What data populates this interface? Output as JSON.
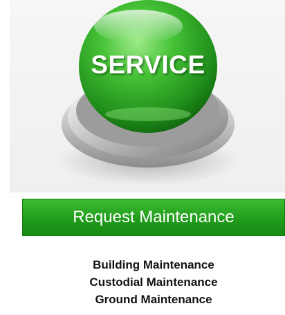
{
  "service_button": {
    "label": "SERVICE",
    "colors": {
      "green_light": "#8fe07a",
      "green_mid": "#33b52a",
      "green_dark": "#0f6e0d",
      "chrome": "#c9c9c9"
    }
  },
  "request_bar": {
    "label": "Request Maintenance",
    "color": "#22a01c"
  },
  "services": [
    {
      "label": "Building Maintenance"
    },
    {
      "label": "Custodial Maintenance"
    },
    {
      "label": "Ground Maintenance"
    }
  ]
}
